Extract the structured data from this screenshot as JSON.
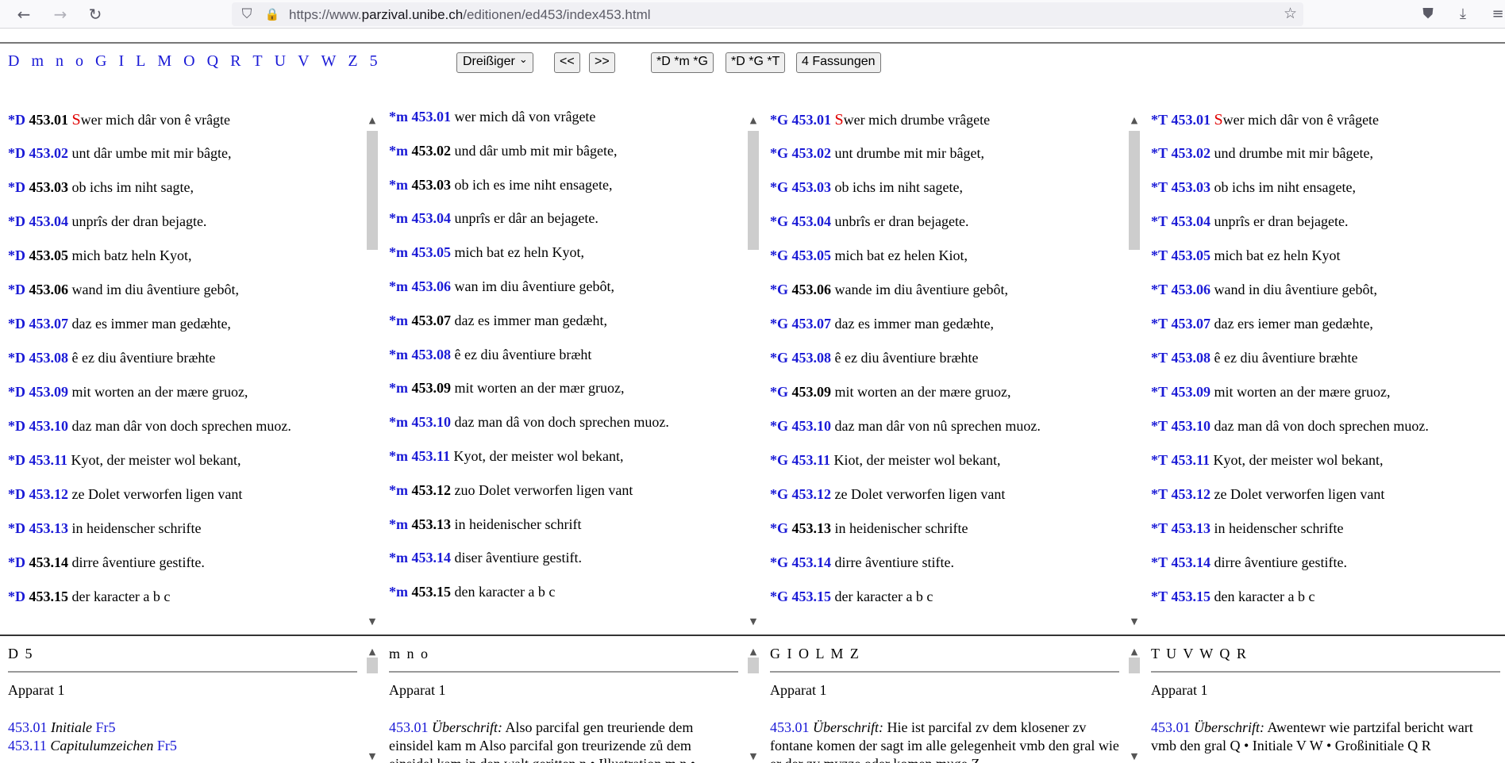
{
  "browser": {
    "url_prefix": "https://www.",
    "url_domain": "parzival.unibe.ch",
    "url_path": "/editionen/ed453/index453.html"
  },
  "nav": {
    "sigla": [
      "D",
      "m",
      "n",
      "o",
      "G",
      "I",
      "L",
      "M",
      "O",
      "Q",
      "R",
      "T",
      "U",
      "V",
      "W",
      "Z",
      "5"
    ],
    "select_value": "Dreißiger",
    "prev": "<<",
    "next": ">>",
    "btn1": "*D *m *G",
    "btn2": "*D *G *T",
    "btn3": "4 Fassungen"
  },
  "columns": [
    {
      "siglum": "*D",
      "lines": [
        {
          "n": "453.01",
          "link": false,
          "initial": "S",
          "text": "wer mich dâr von ê vrâgte"
        },
        {
          "n": "453.02",
          "link": true,
          "text": "unt dâr umbe mit mir bâgte,"
        },
        {
          "n": "453.03",
          "link": false,
          "text": "ob ichs im niht sagte,"
        },
        {
          "n": "453.04",
          "link": true,
          "text": "unprîs der dran bejagte."
        },
        {
          "n": "453.05",
          "link": false,
          "text": "mich batz heln Kyot,"
        },
        {
          "n": "453.06",
          "link": false,
          "text": "wand im diu âventiure gebôt,"
        },
        {
          "n": "453.07",
          "link": true,
          "text": "daz es immer man gedæhte,"
        },
        {
          "n": "453.08",
          "link": true,
          "text": "ê ez diu âventiure bræhte"
        },
        {
          "n": "453.09",
          "link": true,
          "text": "mit worten an der mære gruoz,"
        },
        {
          "n": "453.10",
          "link": true,
          "text": "daz man dâr von doch sprechen muoz."
        },
        {
          "n": "453.11",
          "link": true,
          "text": "Kyot, der meister wol bekant,"
        },
        {
          "n": "453.12",
          "link": true,
          "text": "ze Dolet verworfen ligen vant"
        },
        {
          "n": "453.13",
          "link": true,
          "text": "in heidenscher schrifte"
        },
        {
          "n": "453.14",
          "link": false,
          "text": "dirre âventiure gestifte."
        },
        {
          "n": "453.15",
          "link": false,
          "text": "der karacter a b c"
        }
      ]
    },
    {
      "siglum": "*m",
      "lines": [
        {
          "n": "453.01",
          "link": true,
          "text": "wer mich dâ von vrâgete"
        },
        {
          "n": "453.02",
          "link": false,
          "text": "und dâr umb mit mir bâgete,"
        },
        {
          "n": "453.03",
          "link": false,
          "text": "ob ich es ime niht ensagete,"
        },
        {
          "n": "453.04",
          "link": true,
          "text": "unprîs er dâr an bejagete."
        },
        {
          "n": "453.05",
          "link": true,
          "text": "mich bat ez heln Kyot,"
        },
        {
          "n": "453.06",
          "link": true,
          "text": "wan im diu âventiure gebôt,"
        },
        {
          "n": "453.07",
          "link": false,
          "text": "daz es immer man gedæht,"
        },
        {
          "n": "453.08",
          "link": true,
          "text": "ê ez diu âventiure bræht"
        },
        {
          "n": "453.09",
          "link": false,
          "text": "mit worten an der mær gruoz,"
        },
        {
          "n": "453.10",
          "link": true,
          "text": "daz man dâ von doch sprechen muoz."
        },
        {
          "n": "453.11",
          "link": true,
          "text": "Kyot, der meister wol bekant,"
        },
        {
          "n": "453.12",
          "link": false,
          "text": "zuo Dolet verworfen ligen vant"
        },
        {
          "n": "453.13",
          "link": false,
          "text": "in heidenischer schrift"
        },
        {
          "n": "453.14",
          "link": true,
          "text": "diser âventiure gestift."
        },
        {
          "n": "453.15",
          "link": false,
          "text": "den karacter a b c"
        }
      ]
    },
    {
      "siglum": "*G",
      "lines": [
        {
          "n": "453.01",
          "link": true,
          "initial": "S",
          "text": "wer mich drumbe vrâgete"
        },
        {
          "n": "453.02",
          "link": true,
          "text": "unt drumbe mit mir bâget,"
        },
        {
          "n": "453.03",
          "link": true,
          "text": "ob ichs im niht sagete,"
        },
        {
          "n": "453.04",
          "link": true,
          "text": "unbrîs er dran bejagete."
        },
        {
          "n": "453.05",
          "link": true,
          "text": "mich bat ez helen Kiot,"
        },
        {
          "n": "453.06",
          "link": false,
          "text": "wande im diu âventiure gebôt,"
        },
        {
          "n": "453.07",
          "link": true,
          "text": "daz es immer man gedæhte,"
        },
        {
          "n": "453.08",
          "link": true,
          "text": "ê ez diu âventiure bræhte"
        },
        {
          "n": "453.09",
          "link": false,
          "text": "mit worten an der mære gruoz,"
        },
        {
          "n": "453.10",
          "link": true,
          "text": "daz man dâr von nû sprechen muoz."
        },
        {
          "n": "453.11",
          "link": true,
          "text": "Kiot, der meister wol bekant,"
        },
        {
          "n": "453.12",
          "link": true,
          "text": "ze Dolet verworfen ligen vant"
        },
        {
          "n": "453.13",
          "link": false,
          "text": "in heidenischer schrifte"
        },
        {
          "n": "453.14",
          "link": true,
          "text": "dirre âventiure stifte."
        },
        {
          "n": "453.15",
          "link": true,
          "text": "der karacter a b c"
        }
      ]
    },
    {
      "siglum": "*T",
      "lines": [
        {
          "n": "453.01",
          "link": true,
          "initial": "S",
          "text": "wer mich dâr von ê vrâgete"
        },
        {
          "n": "453.02",
          "link": true,
          "text": "und drumbe mit mir bâgete,"
        },
        {
          "n": "453.03",
          "link": true,
          "text": "ob ichs im niht ensagete,"
        },
        {
          "n": "453.04",
          "link": true,
          "text": "unprîs er dran bejagete."
        },
        {
          "n": "453.05",
          "link": true,
          "text": "mich bat ez heln Kyot"
        },
        {
          "n": "453.06",
          "link": true,
          "text": "wand in diu âventiure gebôt,"
        },
        {
          "n": "453.07",
          "link": true,
          "text": "daz ers iemer man gedæhte,"
        },
        {
          "n": "453.08",
          "link": true,
          "text": "ê ez diu âventiure bræhte"
        },
        {
          "n": "453.09",
          "link": true,
          "text": "mit worten an der mære gruoz,"
        },
        {
          "n": "453.10",
          "link": true,
          "text": "daz man dâ von doch sprechen muoz."
        },
        {
          "n": "453.11",
          "link": true,
          "text": "Kyot, der meister wol bekant,"
        },
        {
          "n": "453.12",
          "link": true,
          "text": "ze Dolet verworfen ligen vant"
        },
        {
          "n": "453.13",
          "link": true,
          "text": "in heidenscher schrifte"
        },
        {
          "n": "453.14",
          "link": true,
          "text": "dirre âventiure gestifte."
        },
        {
          "n": "453.15",
          "link": true,
          "text": "den karacter a b c"
        }
      ]
    }
  ],
  "panels": [
    {
      "header": "D 5",
      "apparat": "Apparat 1",
      "entries": [
        {
          "num": "453.01",
          "label": "Initiale",
          "text": "",
          "ref": "Fr5"
        },
        {
          "num": "453.11",
          "label": "Capitulumzeichen",
          "text": "",
          "ref": "Fr5"
        }
      ]
    },
    {
      "header": "m n o",
      "apparat": "Apparat 1",
      "entries": [
        {
          "num": "453.01",
          "label": "Überschrift:",
          "text": "Also parcifal gen treuriende dem einsidel kam m Also parcifal gon treurizende zů dem einsidel kam in den walt geritten n • Illustration m n •",
          "ref": ""
        }
      ]
    },
    {
      "header": "G I O L M Z",
      "apparat": "Apparat 1",
      "entries": [
        {
          "num": "453.01",
          "label": "Überschrift:",
          "text": "Hie ist parcifal zv dem klosener zv fontane komen der sagt im alle gelegenheit vmb den gral wie er der zv mvzze oder komen muge Z",
          "ref": ""
        }
      ]
    },
    {
      "header": "T U V W Q R",
      "apparat": "Apparat 1",
      "entries": [
        {
          "num": "453.01",
          "label": "Überschrift:",
          "text": "Awentewr wie partzifal bericht wart vmb den gral Q • Initiale V W • Großinitiale Q R",
          "ref": ""
        }
      ]
    }
  ]
}
